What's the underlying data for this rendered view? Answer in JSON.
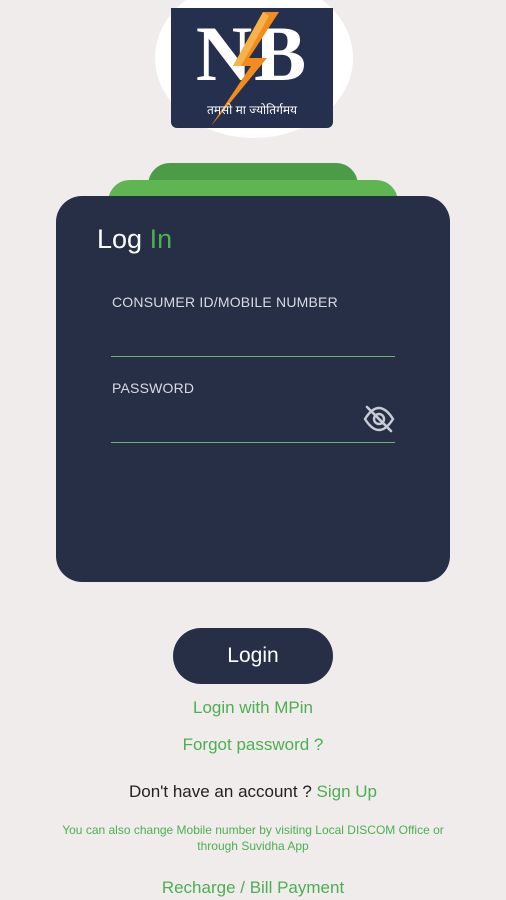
{
  "logo": {
    "letters": "NB",
    "tagline": "तमसो मा ज्योतिर्गमय"
  },
  "card": {
    "title_part1": "Log",
    "title_part2": "In",
    "consumer_label": "CONSUMER ID/MOBILE NUMBER",
    "consumer_value": "",
    "password_label": "PASSWORD",
    "password_value": ""
  },
  "actions": {
    "login_label": "Login",
    "mpin_label": "Login with MPin",
    "forgot_label": "Forgot password ?",
    "no_account_text": "Don't have an account ?",
    "signup_label": "Sign Up",
    "note_text": "You can also change Mobile number by visiting Local DISCOM Office or through Suvidha App",
    "recharge_label": "Recharge / Bill Payment"
  },
  "icons": {
    "password_toggle": "eye-slash-icon",
    "logo_bolt": "lightning-bolt-icon"
  },
  "colors": {
    "background": "#f0ecec",
    "card": "#262f45",
    "accent_green": "#4caf50",
    "logo_navy": "#24304d",
    "bolt_orange": "#f28c1e"
  }
}
